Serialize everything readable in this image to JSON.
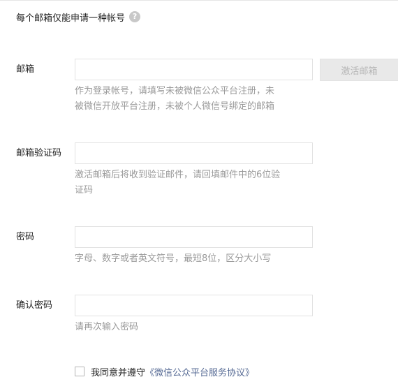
{
  "notice": {
    "text": "每个邮箱仅能申请一种帐号",
    "help_icon": "?"
  },
  "fields": {
    "email": {
      "label": "邮箱",
      "value": "",
      "hint_line1": "作为登录帐号，请填写未被微信公众平台注册，未",
      "hint_line2": "被微信开放平台注册，未被个人微信号绑定的邮箱",
      "button_label": "激活邮箱"
    },
    "code": {
      "label": "邮箱验证码",
      "value": "",
      "hint_line1": "激活邮箱后将收到验证邮件，请回填邮件中的6位验",
      "hint_line2": "证码"
    },
    "password": {
      "label": "密码",
      "value": "",
      "hint": "字母、数字或者英文符号，最短8位，区分大小写"
    },
    "confirm": {
      "label": "确认密码",
      "value": "",
      "hint": "请再次输入密码"
    }
  },
  "agreement": {
    "checked": false,
    "prefix": "我同意并遵守",
    "link_text": "《微信公众平台服务协议》"
  },
  "colors": {
    "link": "#576b95",
    "hint": "#9a9a9a",
    "button_bg": "#e9e9e9",
    "button_text": "#b6b6b6"
  }
}
